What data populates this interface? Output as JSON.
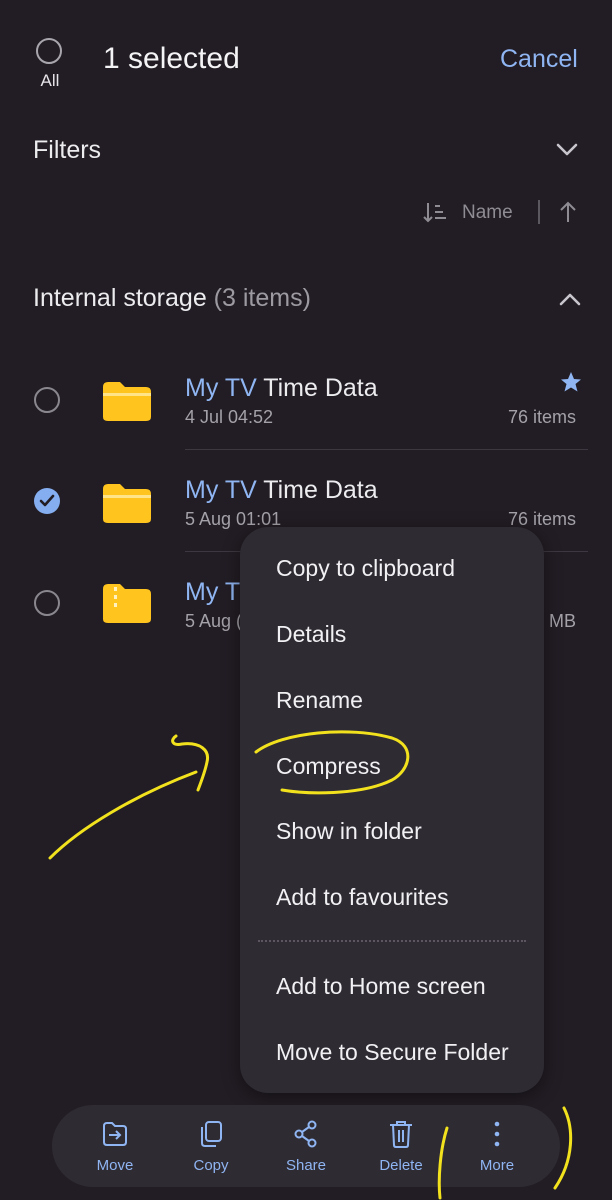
{
  "header": {
    "all_label": "All",
    "title": "1 selected",
    "cancel_label": "Cancel"
  },
  "filters": {
    "label": "Filters"
  },
  "sort": {
    "label": "Name"
  },
  "storage": {
    "title": "Internal storage",
    "count": "(3 items)"
  },
  "files": [
    {
      "name_highlight": "My TV",
      "name_rest": " Time Data",
      "date": "4 Jul 04:52",
      "count": "76 items",
      "selected": false,
      "favourite": true
    },
    {
      "name_highlight": "My TV",
      "name_rest": " Time Data",
      "date": "5 Aug 01:01",
      "count": "76 items",
      "selected": true,
      "favourite": false
    },
    {
      "name_highlight": "My TV",
      "name_rest": "",
      "date": "5 Aug (",
      "count": "MB",
      "selected": false,
      "favourite": false
    }
  ],
  "context_menu": {
    "items": [
      "Copy to clipboard",
      "Details",
      "Rename",
      "Compress",
      "Show in folder",
      "Add to favourites",
      "Add to Home screen",
      "Move to Secure Folder"
    ]
  },
  "bottom_bar": {
    "items": [
      {
        "label": "Move",
        "icon": "move-icon"
      },
      {
        "label": "Copy",
        "icon": "copy-icon"
      },
      {
        "label": "Share",
        "icon": "share-icon"
      },
      {
        "label": "Delete",
        "icon": "trash-icon"
      },
      {
        "label": "More",
        "icon": "more-vertical-icon"
      }
    ]
  },
  "colors": {
    "background": "#221d24",
    "accent": "#8fb5f2",
    "folder": "#ffc41e",
    "annotation": "#f2e21e"
  }
}
